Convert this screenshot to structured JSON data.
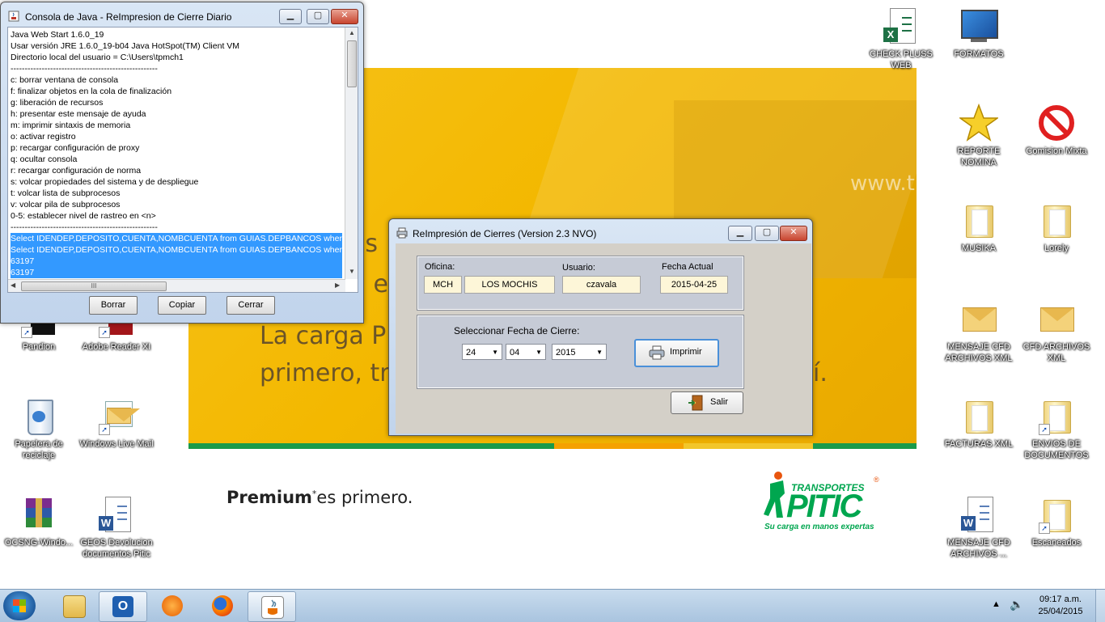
{
  "wallpaper": {
    "banner_line1": "La carga P",
    "banner_line2": "primero, tr",
    "banner_tail": "í.",
    "banner_partial_top": "os",
    "banner_partial_mid": "n e",
    "banner_www": "www.tr",
    "premium_bold": "Premium",
    "premium_star": "*",
    "premium_rest": "es primero.",
    "logo_top": "TRANSPORTES",
    "logo_main": "PITIC",
    "logo_tagline": "Su carga en manos expertas",
    "logo_reg": "®",
    "stripe_colors": [
      "#1a9a4a",
      "#f5a100",
      "#f2c62a",
      "#1a9a4a"
    ]
  },
  "desktop_icons": [
    {
      "label": "CHECK PLUSS WEB"
    },
    {
      "label": "FORMATOS"
    },
    {
      "label": "REPORTE NOMINA"
    },
    {
      "label": "Comision Mixta"
    },
    {
      "label": "MUSIKA"
    },
    {
      "label": "Lorely"
    },
    {
      "label": "MENSAJE CFD ARCHIVOS XML"
    },
    {
      "label": "CFD ARCHIVOS XML"
    },
    {
      "label": "FACTURAS XML"
    },
    {
      "label": "ENVIOS DE DOCUMENTOS"
    },
    {
      "label": "MENSAJE CFD ARCHIVOS ..."
    },
    {
      "label": "Escaneados"
    },
    {
      "label": "Pandion"
    },
    {
      "label": "Adobe Reader XI"
    },
    {
      "label": "Papelera de reciclaje"
    },
    {
      "label": "Windows Live Mail"
    },
    {
      "label": "OCSNG-Windo..."
    },
    {
      "label": "GEOS Devolucion documentos Pitic"
    }
  ],
  "console": {
    "title": "Consola de Java - ReImpresion de Cierre Diario",
    "lines": [
      "Java Web Start 1.6.0_19",
      "Usar versión JRE 1.6.0_19-b04 Java HotSpot(TM) Client VM",
      "Directorio local del usuario = C:\\Users\\tpmch1",
      "----------------------------------------------------",
      "c:   borrar ventana de consola",
      "f:   finalizar objetos en la cola de finalización",
      "g:   liberación de recursos",
      "h:   presentar este mensaje de ayuda",
      "m:   imprimir sintaxis de memoria",
      "o:   activar registro",
      "p:   recargar configuración de proxy",
      "q:   ocultar consola",
      "r:   recargar configuración de norma",
      "s:   volcar propiedades del sistema y de despliegue",
      "t:   volcar lista de subprocesos",
      "v:   volcar pila de subprocesos",
      "0-5: establecer nivel de rastreo en <n>",
      "----------------------------------------------------"
    ],
    "selected_lines": [
      "Select IDENDEP,DEPOSITO,CUENTA,NOMBCUENTA from GUIAS.DEPBANCOS where s",
      "Select IDENDEP,DEPOSITO,CUENTA,NOMBCUENTA from GUIAS.DEPBANCOS where s",
      "63197",
      "63197"
    ],
    "hscroll_grip": "III",
    "buttons": {
      "clear": "Borrar",
      "copy": "Copiar",
      "close": "Cerrar"
    }
  },
  "reimpresion": {
    "title": "ReImpresión de Cierres  (Version 2.3 NVO)",
    "oficina_label": "Oficina:",
    "oficina_code": "MCH",
    "oficina_name": "LOS MOCHIS",
    "usuario_label": "Usuario:",
    "usuario_value": "czavala",
    "fecha_actual_label": "Fecha Actual",
    "fecha_actual_value": "2015-04-25",
    "seleccionar_label": "Seleccionar Fecha de Cierre:",
    "day": "24",
    "month": "04",
    "year": "2015",
    "print_button": "Imprimir",
    "exit_button": "Salir"
  },
  "taskbar": {
    "clock_time": "09:17 a.m.",
    "clock_date": "25/04/2015",
    "items": [
      "explorer-icon",
      "outlook-icon",
      "media-player-icon",
      "firefox-icon",
      "java-icon"
    ]
  }
}
